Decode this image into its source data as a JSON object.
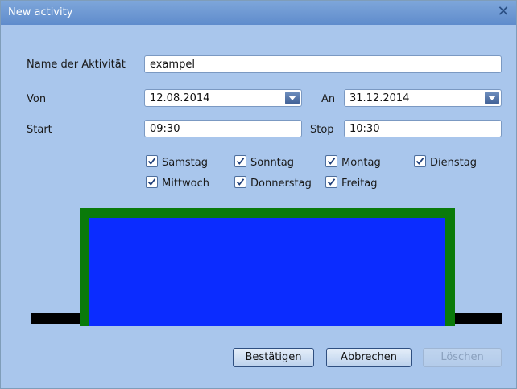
{
  "window": {
    "title": "New activity"
  },
  "form": {
    "name_label": "Name der Aktivität",
    "name_value": "exampel",
    "from_label": "Von",
    "from_value": "12.08.2014",
    "to_label": "An",
    "to_value": "31.12.2014",
    "start_label": "Start",
    "start_value": "09:30",
    "stop_label": "Stop",
    "stop_value": "10:30"
  },
  "days": [
    {
      "label": "Samstag",
      "checked": true
    },
    {
      "label": "Sonntag",
      "checked": true
    },
    {
      "label": "Montag",
      "checked": true
    },
    {
      "label": "Dienstag",
      "checked": true
    },
    {
      "label": "Mittwoch",
      "checked": true
    },
    {
      "label": "Donnerstag",
      "checked": true
    },
    {
      "label": "Freitag",
      "checked": true
    }
  ],
  "preview": {
    "fill_color": "#0b2cff",
    "border_color": "#0a7a0a",
    "baseline_color": "#000000"
  },
  "buttons": {
    "confirm": "Bestätigen",
    "cancel": "Abbrechen",
    "delete": "Löschen",
    "delete_enabled": false
  },
  "icons": {
    "close": "close-icon",
    "dropdown": "chevron-down-icon",
    "checkbox": "checkmark-icon"
  }
}
